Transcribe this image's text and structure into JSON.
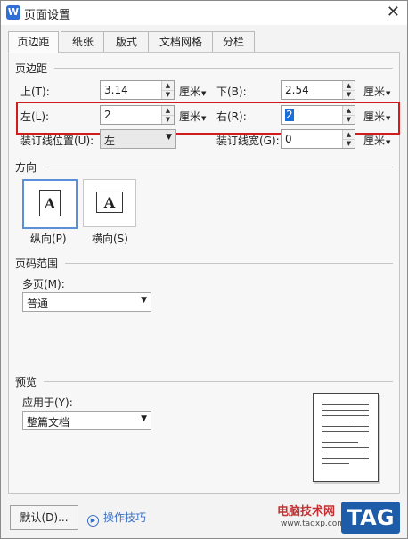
{
  "window": {
    "app_icon": "W",
    "title": "页面设置",
    "close_label": "✕"
  },
  "tabs": [
    {
      "label": "页边距"
    },
    {
      "label": "纸张"
    },
    {
      "label": "版式"
    },
    {
      "label": "文档网格"
    },
    {
      "label": "分栏"
    }
  ],
  "margins": {
    "section_title": "页边距",
    "top": {
      "label": "上(T):",
      "value": "3.14",
      "unit": "厘米"
    },
    "bottom": {
      "label": "下(B):",
      "value": "2.54",
      "unit": "厘米"
    },
    "left": {
      "label": "左(L):",
      "value": "2",
      "unit": "厘米"
    },
    "right": {
      "label": "右(R):",
      "value": "2",
      "unit": "厘米"
    },
    "gutter_position": {
      "label": "装订线位置(U):",
      "value": "左"
    },
    "gutter": {
      "label": "装订线宽(G):",
      "value": "0",
      "unit": "厘米"
    }
  },
  "orientation": {
    "section_title": "方向",
    "glyph": "A",
    "portrait_label": "纵向(P)",
    "landscape_label": "横向(S)",
    "selected": "portrait"
  },
  "page_range": {
    "section_title": "页码范围",
    "multiple_label": "多页(M):",
    "multiple_value": "普通"
  },
  "preview": {
    "section_title": "预览",
    "apply_label": "应用于(Y):",
    "apply_value": "整篇文档"
  },
  "footer": {
    "default_button": "默认(D)...",
    "tips_label": "操作技巧",
    "watermark_text": "电脑技术网",
    "watermark_url": "www.tagxp.com",
    "watermark_logo": "TAG"
  },
  "colors": {
    "highlight": "#d21b1b",
    "selection": "#1a6fd6",
    "link": "#3a6fc4",
    "accent": "#1d5ca8"
  }
}
